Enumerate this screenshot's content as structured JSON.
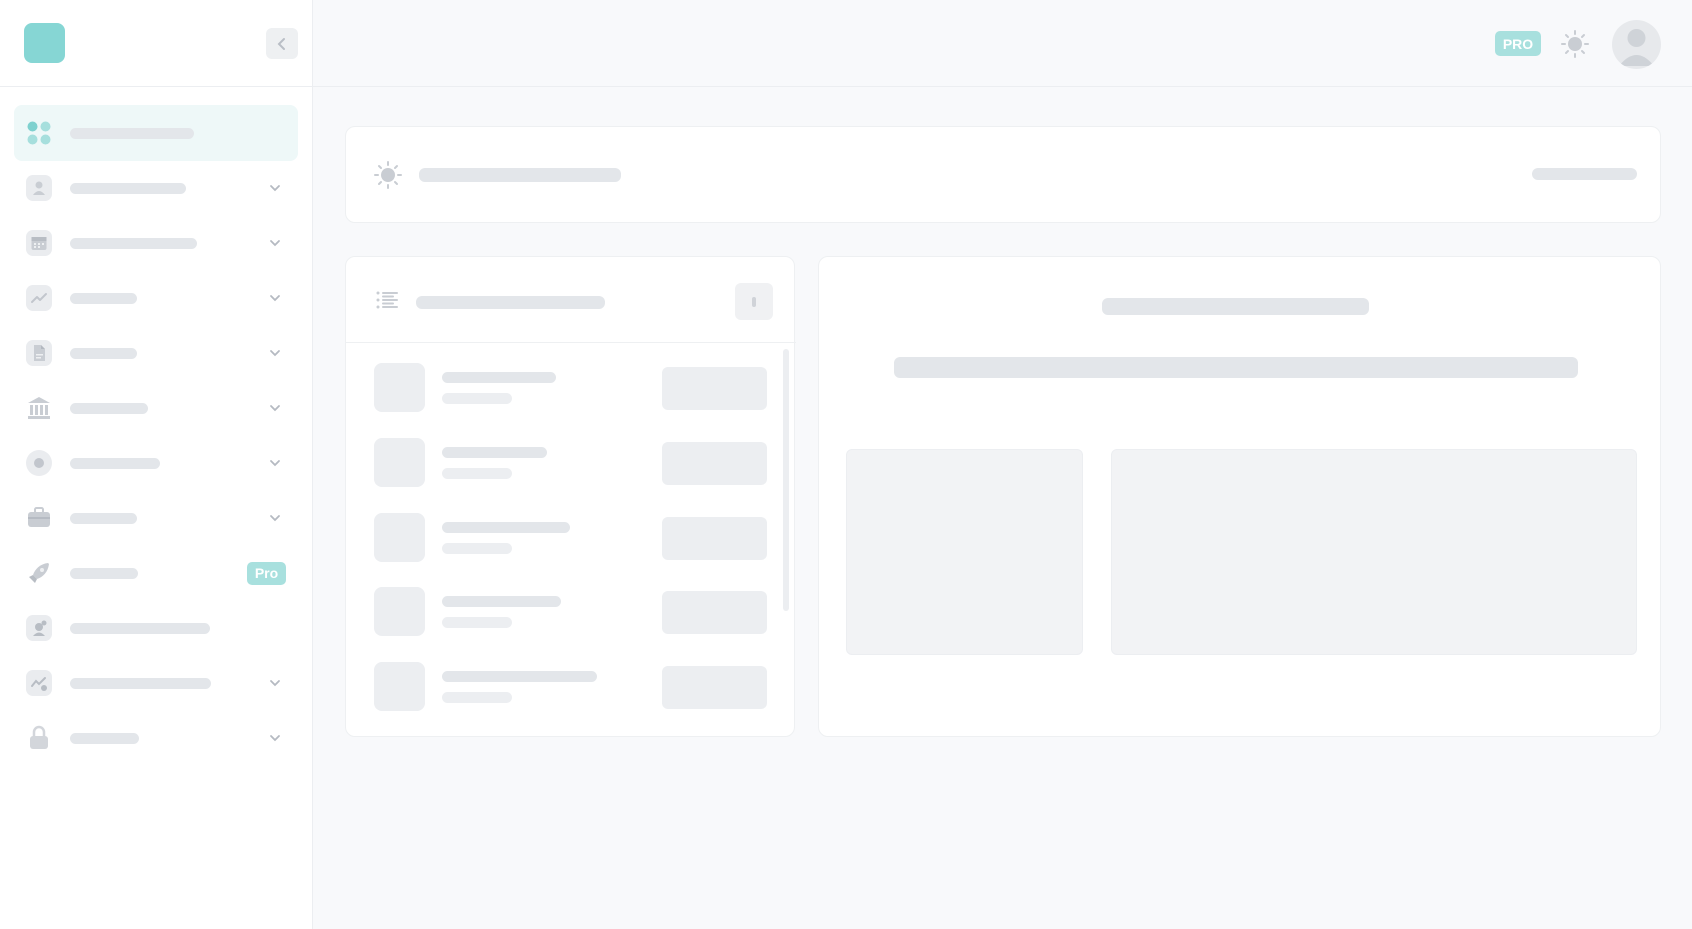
{
  "theme": {
    "accent": "#86d6d4",
    "pro_badge_bg": "#a8e0de",
    "skeleton": "#e3e6ea",
    "surface": "#ffffff",
    "canvas": "#f8f9fb"
  },
  "header": {
    "pro_badge": "PRO"
  },
  "sidebar": {
    "items": [
      {
        "icon": "dashboard-grid-icon",
        "active": true,
        "expandable": false
      },
      {
        "icon": "user-icon",
        "expandable": true
      },
      {
        "icon": "calendar-icon",
        "expandable": true
      },
      {
        "icon": "chart-line-icon",
        "expandable": true
      },
      {
        "icon": "document-icon",
        "expandable": true
      },
      {
        "icon": "bank-icon",
        "expandable": true
      },
      {
        "icon": "record-icon",
        "expandable": true
      },
      {
        "icon": "briefcase-icon",
        "expandable": true
      },
      {
        "icon": "rocket-icon",
        "expandable": false,
        "badge": "Pro"
      },
      {
        "icon": "profile-card-icon",
        "expandable": false
      },
      {
        "icon": "analytics-icon",
        "expandable": true
      },
      {
        "icon": "lock-icon",
        "expandable": true
      }
    ]
  },
  "main": {
    "title_card": {
      "icon": "sun-settings-icon"
    },
    "list_card": {
      "icon": "list-icon",
      "rows": 5
    },
    "detail_card": {
      "panels": 2
    }
  }
}
